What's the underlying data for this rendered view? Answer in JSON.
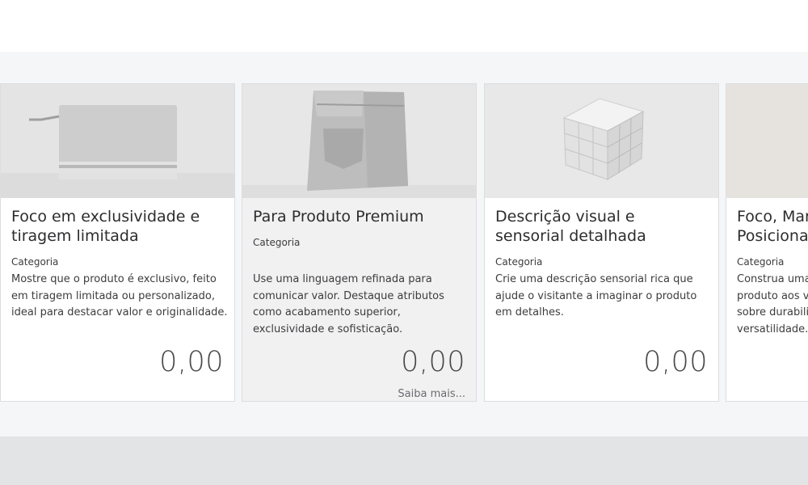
{
  "products": [
    {
      "title": "Foco em exclusividade e tiragem limitada",
      "category": "Categoria",
      "description": "Mostre que o produto é exclusivo, feito em tiragem limitada ou personalizado, ideal para destacar valor e originalidade.",
      "price": "0,00",
      "image_subject": "pouch-image"
    },
    {
      "title": "Para Produto Premium",
      "category": "Categoria",
      "description": "Use uma linguagem refinada para comunicar valor. Destaque atributos como acabamento superior, exclusividade e sofisticação.",
      "price": "0,00",
      "more_label": "Saiba mais...",
      "image_subject": "jeans-image"
    },
    {
      "title": "Descrição visual e sensorial detalhada",
      "category": "Categoria",
      "description": "Crie uma descrição sensorial rica que ajude o visitante a imaginar o produto em detalhes.",
      "price": "0,00",
      "image_subject": "cube-image"
    },
    {
      "title": "Foco, Mar Posiciona",
      "category": "Categoria",
      "description": "Construa uma produto aos va sobre durabili versatilidade.",
      "image_subject": "partial-image"
    }
  ]
}
